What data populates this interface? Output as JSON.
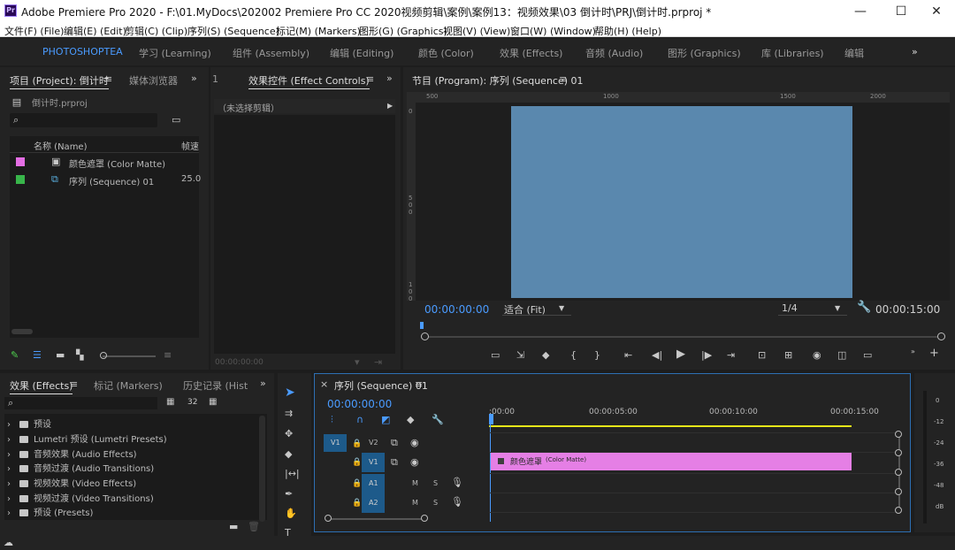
{
  "window": {
    "title": "Adobe Premiere Pro 2020 - F:\\01.MyDocs\\202002 Premiere Pro CC 2020视频剪辑\\案例\\案例13：视频效果\\03 倒计时\\PRJ\\倒计时.prproj *",
    "app_icon": "Pr",
    "minimize": "—",
    "maximize": "☐",
    "close": "✕"
  },
  "menu": [
    "文件(F) (File)",
    "编辑(E) (Edit)",
    "剪辑(C) (Clip)",
    "序列(S) (Sequence)",
    "标记(M) (Markers)",
    "图形(G) (Graphics)",
    "视图(V) (View)",
    "窗口(W) (Window)",
    "帮助(H) (Help)"
  ],
  "workspaces": {
    "items": [
      "PHOTOSHOPTEA",
      "学习 (Learning)",
      "组件 (Assembly)",
      "编辑 (Editing)",
      "颜色 (Color)",
      "效果 (Effects)",
      "音频 (Audio)",
      "图形 (Graphics)",
      "库 (Libraries)",
      "编辑"
    ],
    "overflow": "»"
  },
  "project_panel": {
    "tab_project": "项目 (Project): 倒计时",
    "tab_media": "媒体浏览器",
    "filename": "倒计时.prproj",
    "col_name": "名称 (Name)",
    "col_rate": "帧速",
    "items": [
      {
        "name": "颜色遮罩 (Color Matte)",
        "color": "#e46ee4",
        "rate": ""
      },
      {
        "name": "序列 (Sequence) 01",
        "color": "#38b54a",
        "rate": "25.0"
      }
    ]
  },
  "effect_controls": {
    "tab": "效果控件 (Effect Controls)",
    "no_clip": "（未选择剪辑）",
    "timecode": "00:00:00:00"
  },
  "program_monitor": {
    "tab": "节目 (Program): 序列 (Sequence) 01",
    "ruler_h": [
      "500",
      "1000",
      "1500",
      "2000"
    ],
    "ruler_v": [
      "0",
      "5 0 0",
      "1 0 0"
    ],
    "timecode": "00:00:00:00",
    "fit": "适合 (Fit)",
    "resolution": "1/4",
    "duration": "00:00:15:00",
    "frame_color": "#5a88ae"
  },
  "effects_panel": {
    "tab_effects": "效果 (Effects)",
    "tab_markers": "标记 (Markers)",
    "tab_history": "历史记录 (Hist",
    "overflow": "»",
    "items": [
      "预设",
      "Lumetri 预设 (Lumetri Presets)",
      "音频效果 (Audio Effects)",
      "音频过渡 (Audio Transitions)",
      "视频效果 (Video Effects)",
      "视频过渡 (Video Transitions)",
      "预设 (Presets)"
    ]
  },
  "timeline": {
    "tab": "序列 (Sequence) 01",
    "timecode": "00:00:00:00",
    "ruler": [
      ":00:00",
      "00:00:05:00",
      "00:00:10:00",
      "00:00:15:00"
    ],
    "tracks": [
      {
        "src": "V1",
        "name": "V2"
      },
      {
        "src": "",
        "name": "V1"
      },
      {
        "src": "",
        "name": "A1"
      },
      {
        "src": "",
        "name": "A2"
      }
    ],
    "mute": "M",
    "solo": "S",
    "clip_label": "颜色遮罩",
    "clip_sub": "(Color Matte)",
    "clip_color": "#e57fe5"
  },
  "audio_meter": {
    "labels": [
      "0",
      "-12",
      "-24",
      "-36",
      "-48",
      "dB"
    ]
  },
  "icons": [
    "search-icon",
    "folder-icon",
    "play-icon",
    "wrench-icon",
    "camera-icon",
    "selection-tool-icon",
    "razor-tool-icon",
    "hand-tool-icon",
    "pen-tool-icon",
    "eye-icon",
    "lock-icon",
    "microphone-icon",
    "magnet-icon",
    "marker-icon"
  ]
}
